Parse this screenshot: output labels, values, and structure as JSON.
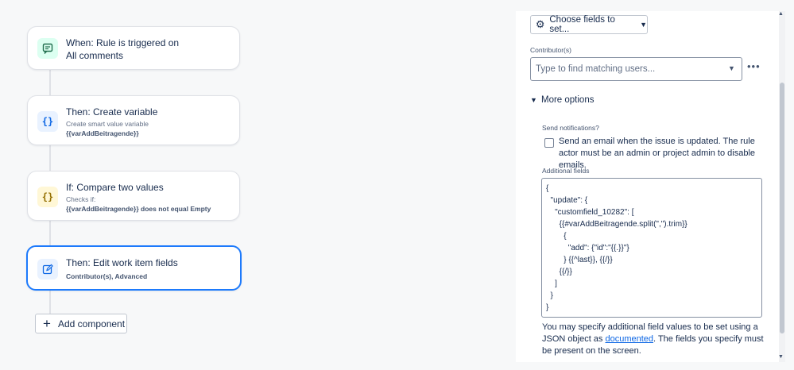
{
  "flow": {
    "trigger": {
      "icon": "comment-icon",
      "title_line1": "When: Rule is triggered on",
      "title_line2": "All comments"
    },
    "create_variable": {
      "icon": "braces-icon",
      "title": "Then: Create variable",
      "subtitle": "Create smart value variable",
      "detail": "{{varAddBeitragende}}"
    },
    "condition": {
      "icon": "braces-icon",
      "title": "If: Compare two values",
      "subtitle": "Checks if:",
      "detail": "{{varAddBeitragende}} does not equal Empty"
    },
    "edit_fields": {
      "icon": "edit-icon",
      "title": "Then: Edit work item fields",
      "detail": "Contributor(s), Advanced"
    },
    "add_component_label": "Add component"
  },
  "panel": {
    "choose_fields_label": "Choose fields to set...",
    "contributor_label": "Contributor(s)",
    "contributor_placeholder": "Type to find matching users...",
    "more_options_label": "More options",
    "send_notifications_label": "Send notifications?",
    "send_notifications_text": "Send an email when the issue is updated. The rule actor must be an admin or project admin to disable emails.",
    "send_notifications_checked": false,
    "additional_fields_label": "Additional fields",
    "additional_fields_json": [
      "{",
      "  \"update\": {",
      "    \"customfield_10282\": [",
      "      {{#varAddBeitragende.split(\",\").trim}}",
      "        {",
      "          \"add\": {\"id\":\"{{.}}\"}",
      "        } {{^last}}, {{/}}",
      "      {{/}}",
      "    ]",
      "  }",
      "}"
    ],
    "help_before": "You may specify additional field values to be set using a JSON object as ",
    "help_link": "documented",
    "help_after": ". The fields you specify must be present on the screen."
  },
  "colors": {
    "accent": "#1d7afc",
    "link": "#0c66e4",
    "trigger_icon_bg": "#dcfff1",
    "action_icon_bg": "#e9f2ff",
    "condition_icon_bg": "#fff7d6"
  }
}
